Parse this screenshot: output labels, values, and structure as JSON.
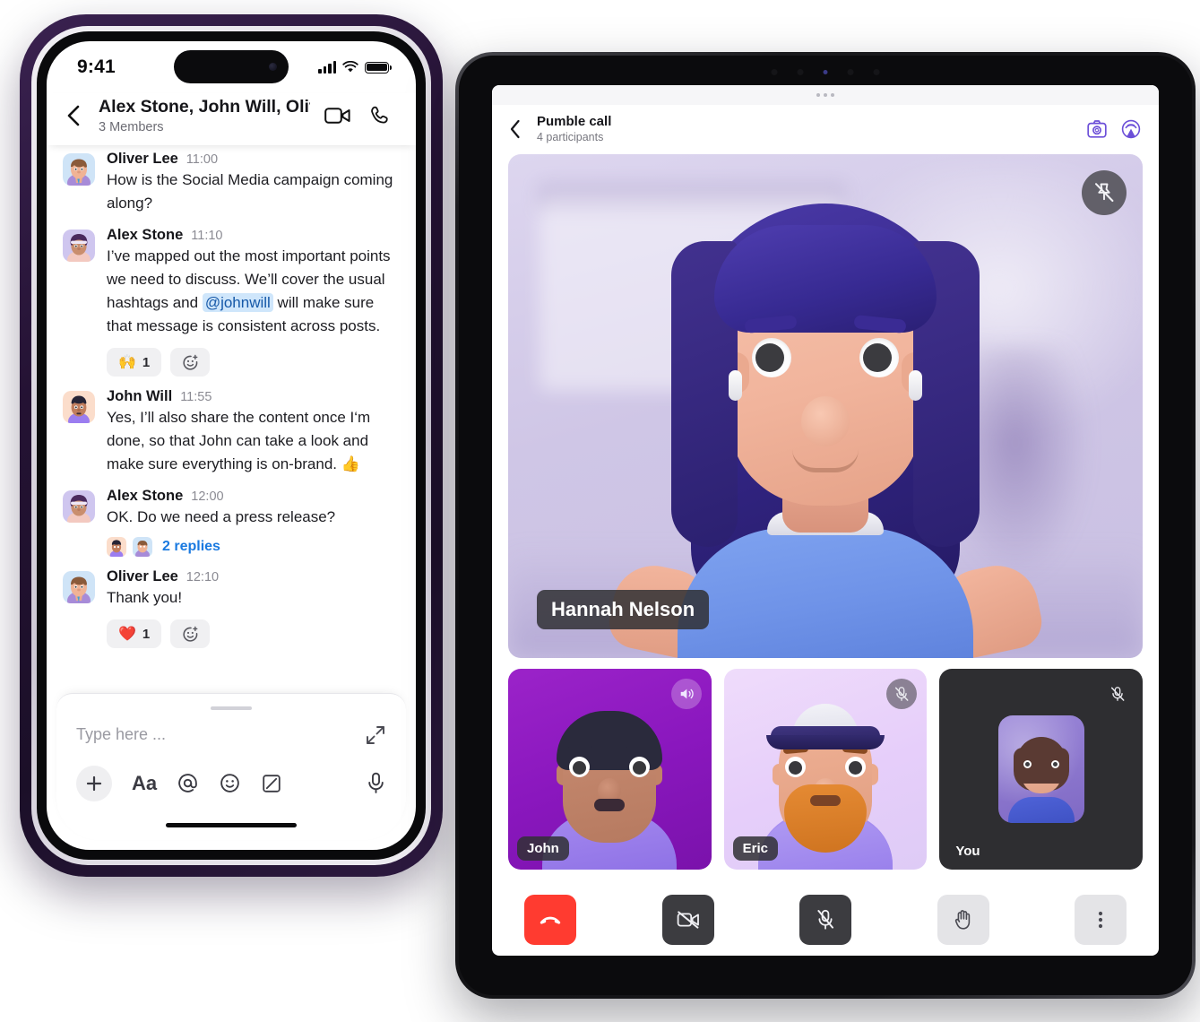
{
  "phone": {
    "status_bar": {
      "time": "9:41",
      "signal_icon": "cellular-signal-icon",
      "wifi_icon": "wifi-icon",
      "battery_icon": "battery-icon"
    },
    "header": {
      "back_icon": "chevron-left-icon",
      "title": "Alex Stone, John Will, Oliver...",
      "subtitle": "3 Members",
      "video_icon": "video-camera-icon",
      "call_icon": "phone-icon"
    },
    "messages": [
      {
        "name": "Oliver Lee",
        "time": "11:00",
        "text": "How is the Social Media campaign coming along?",
        "avatar": "oliver"
      },
      {
        "name": "Alex Stone",
        "time": "11:10",
        "text_before": "I’ve mapped out the most important points we need to discuss. We’ll cover the usual hashtags and ",
        "mention": "@johnwill",
        "text_after": " will make sure that message is consistent across posts.",
        "avatar": "alex",
        "reaction": {
          "emoji": "🙌",
          "count": "1"
        },
        "add_reaction_icon": "add-reaction-icon"
      },
      {
        "name": "John Will",
        "time": "11:55",
        "text": "Yes, I’ll also share the content once I‘m done, so that John can take a look and make sure everything is on-brand. 👍",
        "avatar": "john"
      },
      {
        "name": "Alex Stone",
        "time": "12:00",
        "text": "OK. Do we need a press release?",
        "avatar": "alex",
        "thread_label": "2 replies"
      },
      {
        "name": "Oliver Lee",
        "time": "12:10",
        "text": "Thank you!",
        "avatar": "oliver",
        "reaction": {
          "emoji": "❤️",
          "count": "1"
        },
        "add_reaction_icon": "add-reaction-icon"
      }
    ],
    "composer": {
      "placeholder": "Type here ...",
      "expand_icon": "expand-diagonal-icon",
      "plus_icon": "plus-icon",
      "format_label": "Aa",
      "mention_icon": "at-icon",
      "emoji_icon": "emoji-icon",
      "draw_icon": "draw-icon",
      "mic_icon": "microphone-icon"
    }
  },
  "tablet": {
    "header": {
      "back_icon": "chevron-left-icon",
      "title": "Pumble call",
      "subtitle": "4 participants",
      "switch_camera_icon": "switch-camera-icon",
      "cast_icon": "cast-icon",
      "accent_color": "#6c4fd8"
    },
    "main_tile": {
      "name": "Hannah Nelson",
      "pin_icon": "unpin-icon"
    },
    "thumbnails": [
      {
        "name": "John",
        "badge_icon": "speaker-on-icon",
        "badge_style": "speak"
      },
      {
        "name": "Eric",
        "badge_icon": "microphone-muted-icon",
        "badge_style": "mute"
      },
      {
        "name": "You",
        "badge_icon": "microphone-muted-icon",
        "badge_style": "flat"
      }
    ],
    "controls": [
      {
        "name": "end-call",
        "icon": "phone-hangup-icon",
        "style": "end"
      },
      {
        "name": "camera-off",
        "icon": "video-camera-off-icon",
        "style": "dark"
      },
      {
        "name": "mic-off",
        "icon": "microphone-muted-icon",
        "style": "dark"
      },
      {
        "name": "raise-hand",
        "icon": "raised-hand-icon",
        "style": "light"
      },
      {
        "name": "more",
        "icon": "more-vertical-icon",
        "style": "light"
      }
    ]
  }
}
